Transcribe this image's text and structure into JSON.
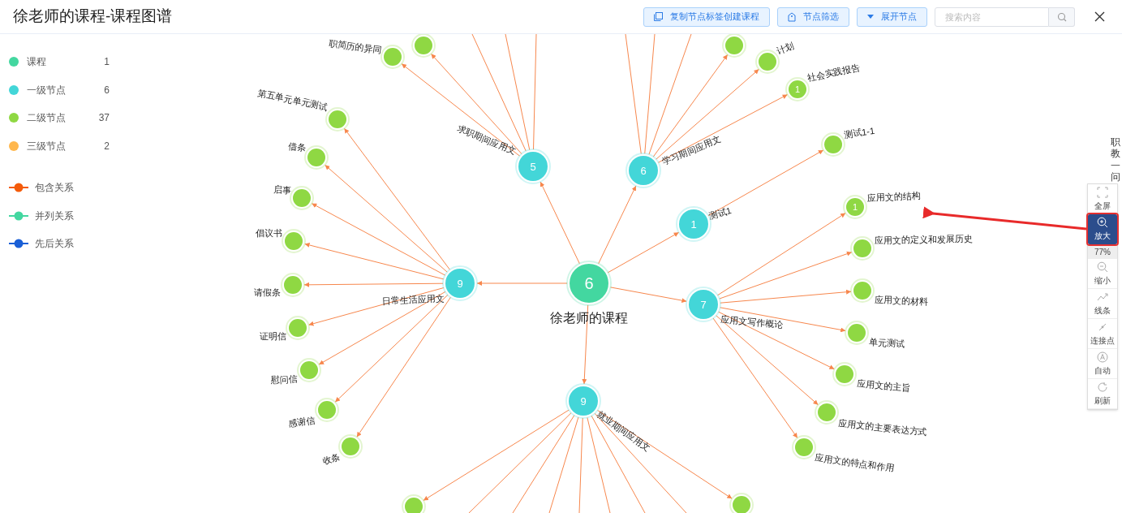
{
  "title": "徐老师的课程-课程图谱",
  "toolbar": {
    "buttons": [
      {
        "label": "复制节点标签创建课程",
        "kind": "copy"
      },
      {
        "label": "节点筛选",
        "kind": "tag"
      },
      {
        "label": "展开节点",
        "kind": "caret"
      }
    ],
    "search": {
      "placeholder": "搜索内容"
    }
  },
  "legend": {
    "node_types": [
      {
        "label": "课程",
        "count": "1",
        "color": "#43d7a0"
      },
      {
        "label": "一级节点",
        "count": "6",
        "color": "#43d6d8"
      },
      {
        "label": "二级节点",
        "count": "37",
        "color": "#8fd843"
      },
      {
        "label": "三级节点",
        "count": "2",
        "color": "#ffb74d"
      }
    ],
    "relations": [
      {
        "label": "包含关系",
        "color": "#f45b0a"
      },
      {
        "label": "并列关系",
        "color": "#43d7a0"
      },
      {
        "label": "先后关系",
        "color": "#1a5fd6"
      }
    ]
  },
  "graph": {
    "root": {
      "badge": "6",
      "label": "徐老师的课程",
      "children": [
        {
          "badge": "5",
          "label": "求职期间应用文",
          "children": [
            {
              "label": "职简历的异同"
            },
            {
              "kind": "node"
            },
            {
              "kind": "offscreen"
            },
            {
              "kind": "offscreen"
            },
            {
              "kind": "offscreen"
            }
          ]
        },
        {
          "badge": "6",
          "label": "学习期间应用文",
          "children": [
            {
              "kind": "node"
            },
            {
              "label": "计划"
            },
            {
              "badge": "1",
              "label": "社会实践报告"
            },
            {
              "kind": "offscreen"
            },
            {
              "kind": "offscreen"
            },
            {
              "kind": "offscreen"
            }
          ]
        },
        {
          "badge": "1",
          "label": "测试1",
          "children": [
            {
              "label": "测试1-1"
            }
          ]
        },
        {
          "badge": "7",
          "label": "应用文写作概论",
          "children": [
            {
              "badge": "1",
              "label": "应用文的结构"
            },
            {
              "label": "应用文的定义和发展历史"
            },
            {
              "label": "应用文的材料"
            },
            {
              "label": "单元测试"
            },
            {
              "label": "应用文的主旨"
            },
            {
              "label": "应用文的主要表达方式"
            },
            {
              "label": "应用文的特点和作用"
            }
          ]
        },
        {
          "badge": "9",
          "label": "就业期间应用文",
          "children": [
            {
              "kind": "node"
            },
            {
              "kind": "node"
            },
            {
              "kind": "offscreen"
            },
            {
              "kind": "offscreen"
            },
            {
              "kind": "offscreen"
            },
            {
              "kind": "offscreen"
            },
            {
              "kind": "offscreen"
            },
            {
              "kind": "offscreen"
            },
            {
              "kind": "offscreen"
            }
          ]
        },
        {
          "badge": "9",
          "label": "日常生活应用文",
          "children": [
            {
              "label": "第五单元单元测试"
            },
            {
              "label": "借条"
            },
            {
              "label": "启事"
            },
            {
              "label": "倡议书"
            },
            {
              "label": "请假条"
            },
            {
              "label": "证明信"
            },
            {
              "label": "慰问信"
            },
            {
              "label": "感谢信"
            },
            {
              "label": "收条"
            }
          ]
        }
      ]
    }
  },
  "side_tools": [
    {
      "label": "全屏",
      "kind": "fullscreen",
      "selected": false
    },
    {
      "label": "放大",
      "kind": "zoomin",
      "selected": true
    },
    {
      "label": "77%",
      "kind": "readout",
      "selected": false
    },
    {
      "label": "缩小",
      "kind": "zoomout",
      "selected": false
    },
    {
      "label": "线条",
      "kind": "lines",
      "selected": false
    },
    {
      "label": "连接点",
      "kind": "points",
      "selected": false
    },
    {
      "label": "自动",
      "kind": "auto",
      "selected": false
    },
    {
      "label": "刷新",
      "kind": "refresh",
      "selected": false
    }
  ],
  "side_text": "职教一问"
}
